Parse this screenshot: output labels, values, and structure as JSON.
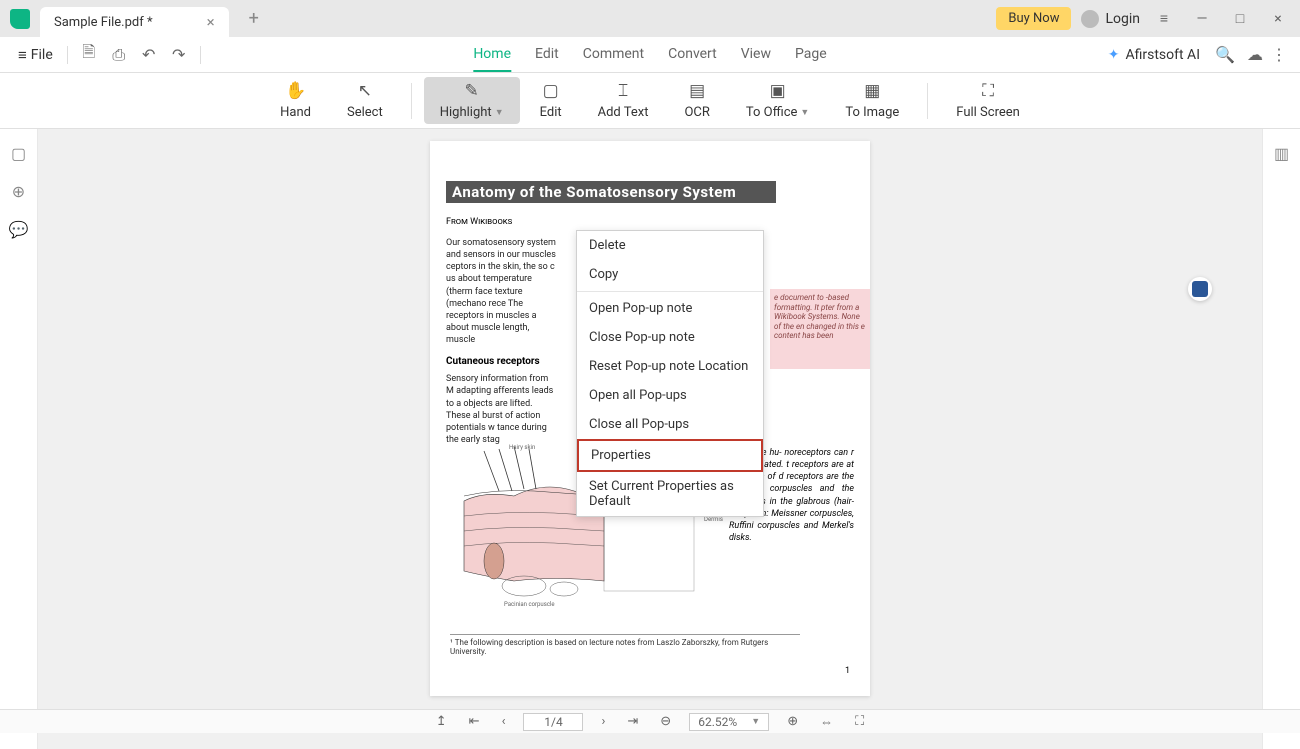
{
  "titlebar": {
    "tab_title": "Sample File.pdf *",
    "buy_now": "Buy Now",
    "login": "Login"
  },
  "menubar": {
    "file": "File",
    "tabs": [
      "Home",
      "Edit",
      "Comment",
      "Convert",
      "View",
      "Page"
    ],
    "active_tab": 0,
    "ai": "Afirstsoft AI"
  },
  "ribbon": {
    "items": [
      {
        "label": "Hand",
        "icon": "✋"
      },
      {
        "label": "Select",
        "icon": "↖"
      },
      {
        "label": "Highlight",
        "icon": "✎",
        "dropdown": true,
        "highlighted": true
      },
      {
        "label": "Edit",
        "icon": "▢"
      },
      {
        "label": "Add Text",
        "icon": "⌶"
      },
      {
        "label": "OCR",
        "icon": "▤"
      },
      {
        "label": "To Office",
        "icon": "▣",
        "dropdown": true
      },
      {
        "label": "To Image",
        "icon": "▦"
      },
      {
        "label": "Full Screen",
        "icon": "⛶"
      }
    ]
  },
  "document": {
    "title": "Anatomy of the Somatosensory System",
    "source": "From Wikibooks",
    "para1": "Our somatosensory system and sensors in our muscles ceptors in the skin, the so c us about temperature (therm face texture (mechano rece The receptors in muscles a about muscle length, muscle",
    "sub1": "Cutaneous receptors",
    "para2": "Sensory information from M adapting afferents leads to a objects are lifted. These al burst of action potentials w tance during the early stag",
    "note": "e document to -based formatting. It pter from a Wikibook Systems. None of the en changed in this e content has been",
    "rightcol": "ors in the hu- noreceptors can r encapsulated. t receptors are at the roots of d receptors are the Pacinian corpuscles and the receptors in the glabrous (hair-less) skin: Meissner corpuscles, Ruffini corpuscles and Merkel's disks.",
    "footnote": "¹ The following description is based on lecture notes from Laszlo Zaborszky, from Rutgers University.",
    "page_num": "1"
  },
  "context_menu": {
    "items": [
      "Delete",
      "Copy",
      "Open Pop-up note",
      "Close Pop-up note",
      "Reset Pop-up note Location",
      "Open all Pop-ups",
      "Close all Pop-ups",
      "Properties",
      "Set Current Properties as Default"
    ],
    "highlighted_index": 7
  },
  "statusbar": {
    "page": "1/4",
    "zoom": "62.52%"
  }
}
